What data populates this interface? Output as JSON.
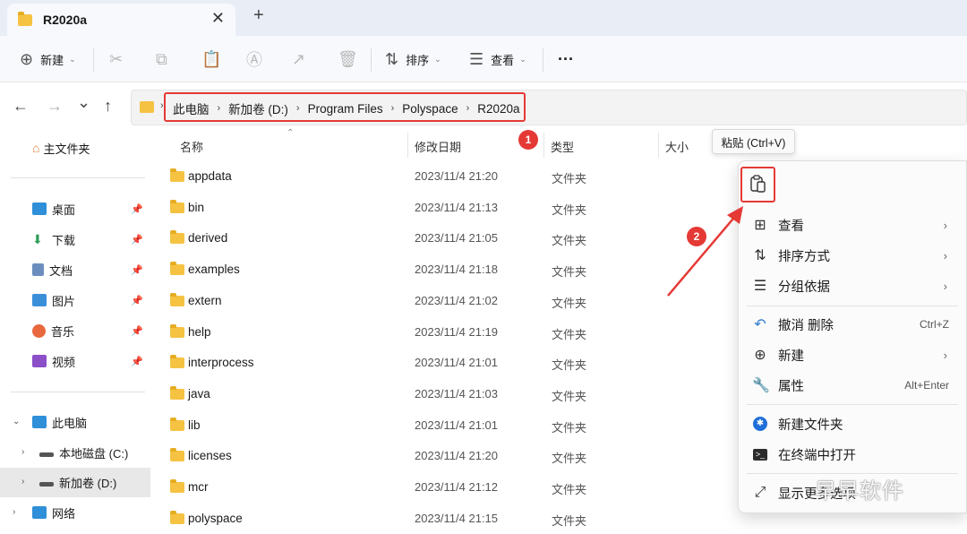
{
  "tab": {
    "title": "R2020a",
    "close": "✕",
    "new_tab": "+"
  },
  "toolbar": {
    "new_label": "新建",
    "sort_label": "排序",
    "view_label": "查看",
    "more": "···"
  },
  "nav": {
    "back": "←",
    "forward": "→",
    "recent": "⌄",
    "up": "↑"
  },
  "breadcrumb": [
    "此电脑",
    "新加卷 (D:)",
    "Program Files",
    "Polyspace",
    "R2020a"
  ],
  "sidebar": {
    "home": "主文件夹",
    "quick": [
      {
        "label": "桌面",
        "color": "#2f8fd8"
      },
      {
        "label": "下载",
        "color": "#2e9e5b"
      },
      {
        "label": "文档",
        "color": "#6c8ebf"
      },
      {
        "label": "图片",
        "color": "#3b8fd9"
      },
      {
        "label": "音乐",
        "color": "#e8673c"
      },
      {
        "label": "视频",
        "color": "#8b4fc8"
      }
    ],
    "this_pc": "此电脑",
    "drives": [
      "本地磁盘 (C:)",
      "新加卷 (D:)"
    ],
    "network": "网络"
  },
  "columns": {
    "name": "名称",
    "modified": "修改日期",
    "type": "类型",
    "size": "大小"
  },
  "files": [
    {
      "name": "appdata",
      "date": "2023/11/4 21:20",
      "type": "文件夹"
    },
    {
      "name": "bin",
      "date": "2023/11/4 21:13",
      "type": "文件夹"
    },
    {
      "name": "derived",
      "date": "2023/11/4 21:05",
      "type": "文件夹"
    },
    {
      "name": "examples",
      "date": "2023/11/4 21:18",
      "type": "文件夹"
    },
    {
      "name": "extern",
      "date": "2023/11/4 21:02",
      "type": "文件夹"
    },
    {
      "name": "help",
      "date": "2023/11/4 21:19",
      "type": "文件夹"
    },
    {
      "name": "interprocess",
      "date": "2023/11/4 21:01",
      "type": "文件夹"
    },
    {
      "name": "java",
      "date": "2023/11/4 21:03",
      "type": "文件夹"
    },
    {
      "name": "lib",
      "date": "2023/11/4 21:01",
      "type": "文件夹"
    },
    {
      "name": "licenses",
      "date": "2023/11/4 21:20",
      "type": "文件夹"
    },
    {
      "name": "mcr",
      "date": "2023/11/4 21:12",
      "type": "文件夹"
    },
    {
      "name": "polyspace",
      "date": "2023/11/4 21:15",
      "type": "文件夹"
    }
  ],
  "annotations": {
    "step1": "1",
    "step2": "2",
    "color": "#e53935"
  },
  "tooltip": "粘贴 (Ctrl+V)",
  "context_menu": {
    "view": "查看",
    "sort_by": "排序方式",
    "group_by": "分组依据",
    "undo": "撤消 删除",
    "undo_shortcut": "Ctrl+Z",
    "new": "新建",
    "properties": "属性",
    "properties_shortcut": "Alt+Enter",
    "new_folder": "新建文件夹",
    "open_terminal": "在终端中打开",
    "show_more": "显示更多选项"
  },
  "watermark": "早早软件"
}
